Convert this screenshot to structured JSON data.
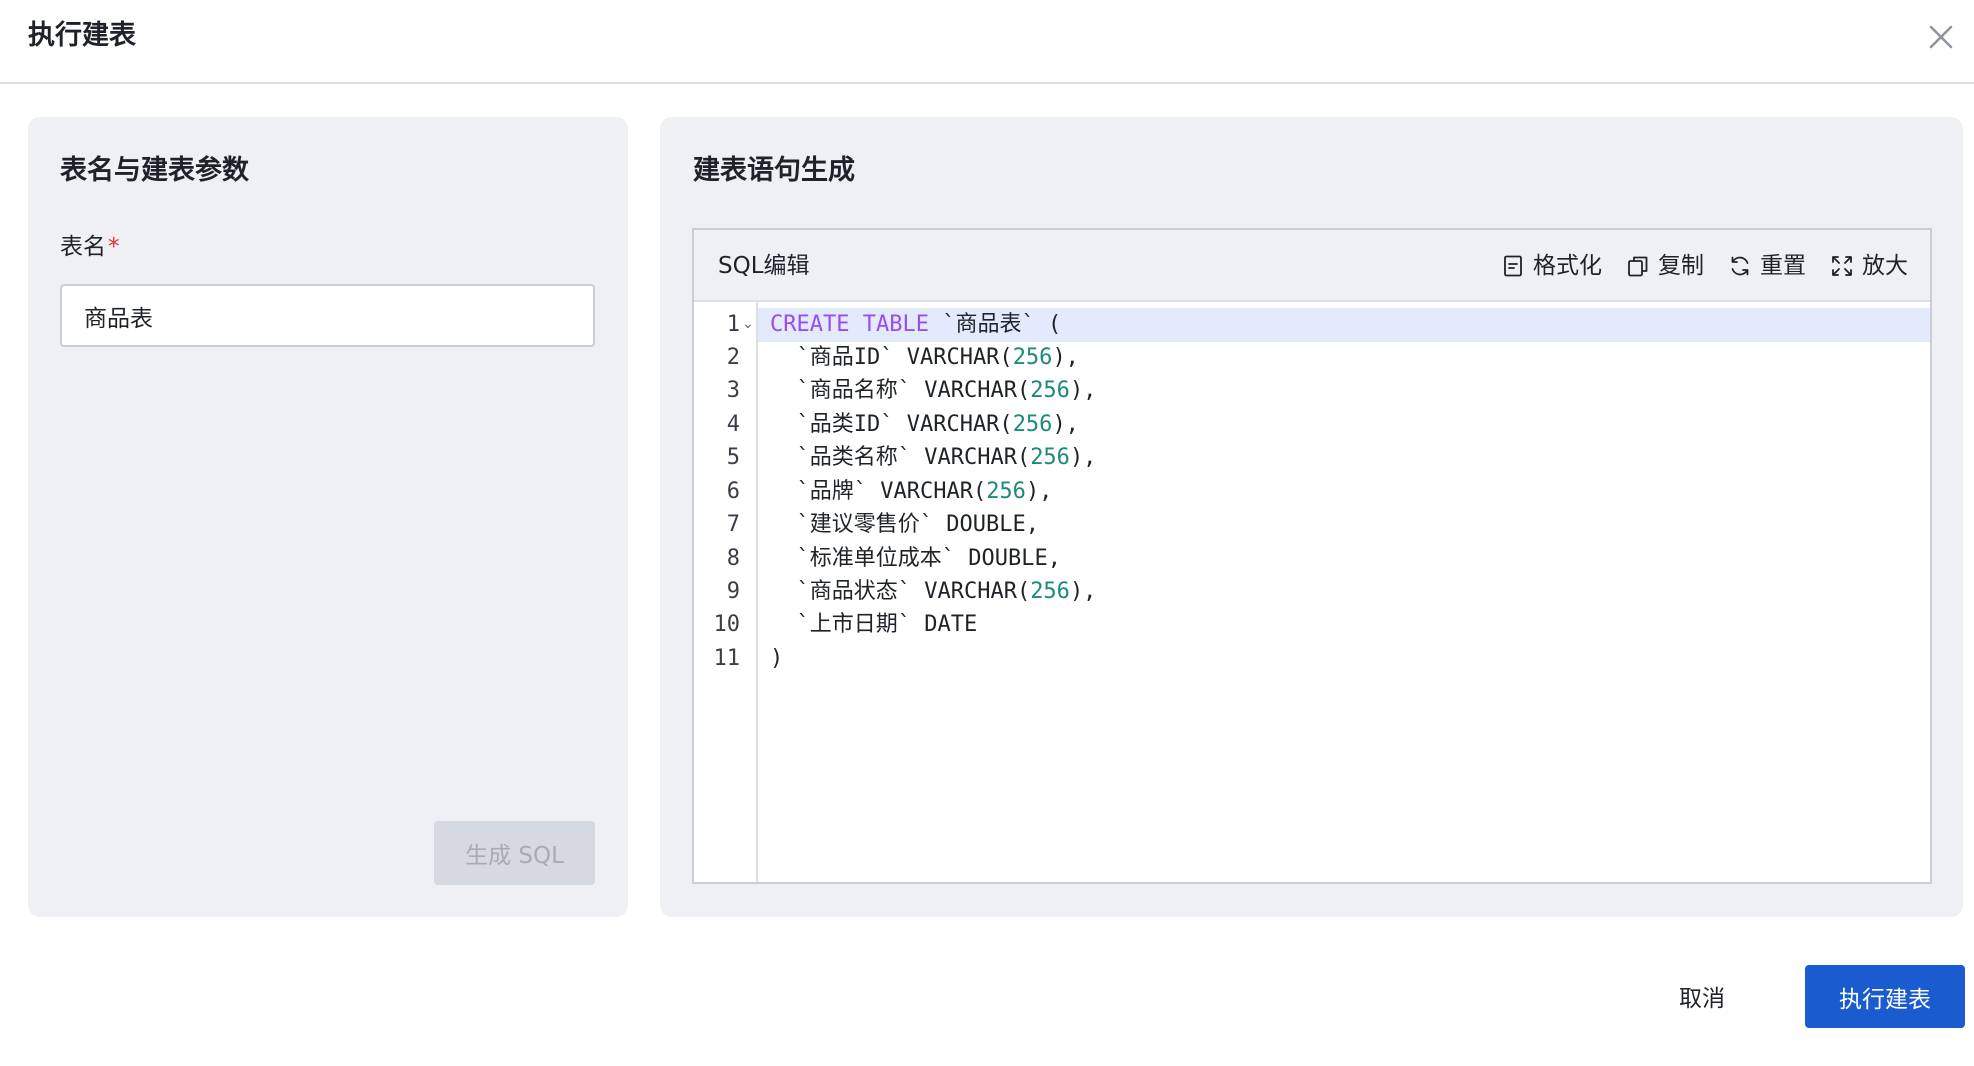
{
  "dialog": {
    "title": "执行建表",
    "close_icon": "close-icon"
  },
  "left_panel": {
    "title": "表名与建表参数",
    "table_name_label": "表名",
    "required_mark": "*",
    "table_name_value": "商品表",
    "generate_button": "生成 SQL"
  },
  "right_panel": {
    "title": "建表语句生成",
    "editor_title": "SQL编辑",
    "toolbar": [
      {
        "label": "格式化",
        "icon": "format-icon"
      },
      {
        "label": "复制",
        "icon": "copy-icon"
      },
      {
        "label": "重置",
        "icon": "reset-icon"
      },
      {
        "label": "放大",
        "icon": "expand-icon"
      }
    ],
    "line_numbers": [
      "1",
      "2",
      "3",
      "4",
      "5",
      "6",
      "7",
      "8",
      "9",
      "10",
      "11"
    ],
    "code_lines": [
      [
        {
          "t": "CREATE",
          "c": "kw"
        },
        {
          "t": " "
        },
        {
          "t": "TABLE",
          "c": "kw"
        },
        {
          "t": " `商品表` ("
        }
      ],
      [
        {
          "t": "  `商品ID` VARCHAR("
        },
        {
          "t": "256",
          "c": "num"
        },
        {
          "t": "),"
        }
      ],
      [
        {
          "t": "  `商品名称` VARCHAR("
        },
        {
          "t": "256",
          "c": "num"
        },
        {
          "t": "),"
        }
      ],
      [
        {
          "t": "  `品类ID` VARCHAR("
        },
        {
          "t": "256",
          "c": "num"
        },
        {
          "t": "),"
        }
      ],
      [
        {
          "t": "  `品类名称` VARCHAR("
        },
        {
          "t": "256",
          "c": "num"
        },
        {
          "t": "),"
        }
      ],
      [
        {
          "t": "  `品牌` VARCHAR("
        },
        {
          "t": "256",
          "c": "num"
        },
        {
          "t": "),"
        }
      ],
      [
        {
          "t": "  `建议零售价` DOUBLE,"
        }
      ],
      [
        {
          "t": "  `标准单位成本` DOUBLE,"
        }
      ],
      [
        {
          "t": "  `商品状态` VARCHAR("
        },
        {
          "t": "256",
          "c": "num"
        },
        {
          "t": "),"
        }
      ],
      [
        {
          "t": "  `上市日期` DATE"
        }
      ],
      [
        {
          "t": ")"
        }
      ]
    ]
  },
  "footer": {
    "cancel_label": "取消",
    "submit_label": "执行建表"
  },
  "colors": {
    "primary": "#1a5bd0",
    "keyword": "#9a4cf0",
    "number": "#1e8a7a",
    "required": "#e5302f",
    "panel_bg": "#eef0f4",
    "active_line": "#e2eafb"
  }
}
